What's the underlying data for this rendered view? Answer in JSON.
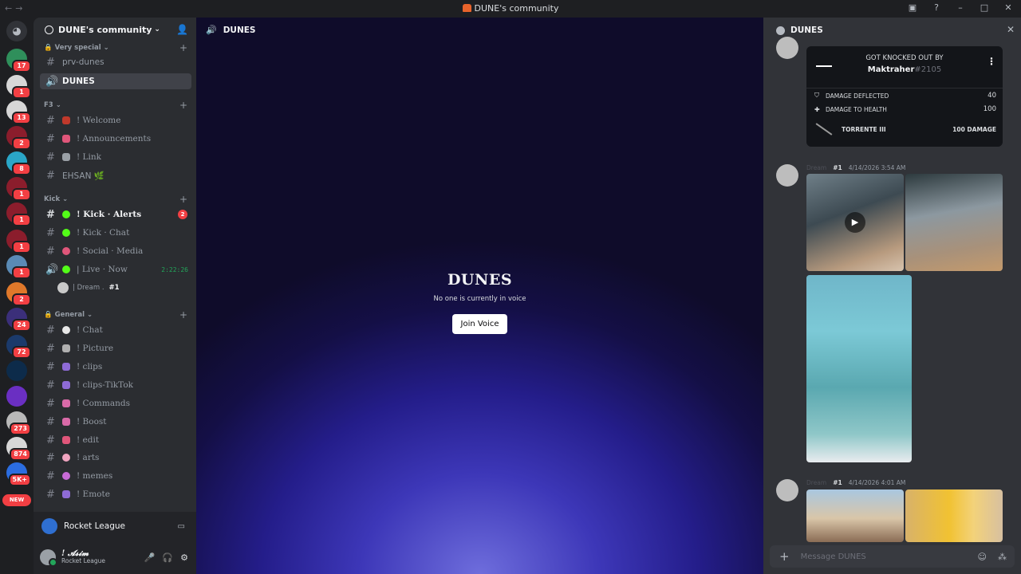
{
  "window": {
    "title": "DUNE's community"
  },
  "servers": [
    {
      "badge": "17",
      "color": "#2f8f5b"
    },
    {
      "badge": "1",
      "color": "#d7d7d7"
    },
    {
      "badge": "13",
      "color": "#d7d7d7"
    },
    {
      "badge": "2",
      "color": "#8b1d2c"
    },
    {
      "badge": "8",
      "color": "#2aa6c7"
    },
    {
      "badge": "1",
      "color": "#8b1d2c"
    },
    {
      "badge": "1",
      "color": "#8b1d2c"
    },
    {
      "badge": "1",
      "color": "#8b1d2c"
    },
    {
      "badge": "1",
      "color": "#5a8ab5"
    },
    {
      "badge": "2",
      "color": "#e0782a"
    },
    {
      "badge": "24",
      "color": "#3b2f7a"
    },
    {
      "badge": "72",
      "color": "#1b3a6b"
    },
    {
      "badge": "",
      "color": "#0d2b4a"
    },
    {
      "badge": "",
      "color": "#6a2fc2"
    },
    {
      "badge": "273",
      "color": "#b9b9b9"
    },
    {
      "badge": "874",
      "color": "#d7d7d7"
    },
    {
      "badge": "5K+",
      "color": "#2b6de0"
    }
  ],
  "new_label": "NEW",
  "sidebar": {
    "server_name": "DUNE's community",
    "categories": {
      "very_special": "Very special",
      "f3": "F3",
      "kick": "Kick",
      "general": "General"
    },
    "channels": {
      "prv": "prv-dunes",
      "dunes": "DUNES",
      "welcome": "! Welcome",
      "announcements": "! Announcements",
      "link": "! Link",
      "ehsan": "EHSAN 🌿",
      "kick_alerts": "! Kick · Alerts",
      "kick_alerts_mention": "2",
      "kick_chat": "! Kick · Chat",
      "social_media": "! Social · Media",
      "live_now": "| Live · Now",
      "live_timer": "2:22:26",
      "chat": "! Chat",
      "picture": "! Picture",
      "clips": "! clips",
      "clips_tiktok": "! clips-TikTok",
      "commands": "! Commands",
      "boost": "! Boost",
      "edit": "! edit",
      "arts": "! arts",
      "memes": "! memes",
      "emote": "! Emote"
    },
    "voice_user": {
      "name": "| Dream .",
      "tag": "#1"
    },
    "activity": "Rocket League",
    "user": {
      "name": "! 𝓐𝓼𝓲𝓶",
      "status": "Rocket League"
    }
  },
  "stage": {
    "header": "DUNES",
    "title": "DUNES",
    "subtitle": "No one is currently in voice",
    "join": "Join Voice"
  },
  "chat": {
    "header": "DUNES",
    "card": {
      "knocked_out": "GOT KNOCKED OUT BY",
      "killer": "Maktraher",
      "killer_tag": "#2105",
      "row1_label": "DAMAGE DEFLECTED",
      "row1_value": "40",
      "row2_label": "DAMAGE TO HEALTH",
      "row2_value": "100",
      "weapon": "TORRENTE III",
      "weapon_damage": "100 DAMAGE"
    },
    "messages": [
      {
        "username": "Dream",
        "tag": "#1",
        "time": "4/14/2026 3:54 AM"
      },
      {
        "username": "Dream",
        "tag": "#1",
        "time": "4/14/2026 4:01 AM"
      }
    ],
    "composer_placeholder": "Message DUNES"
  }
}
